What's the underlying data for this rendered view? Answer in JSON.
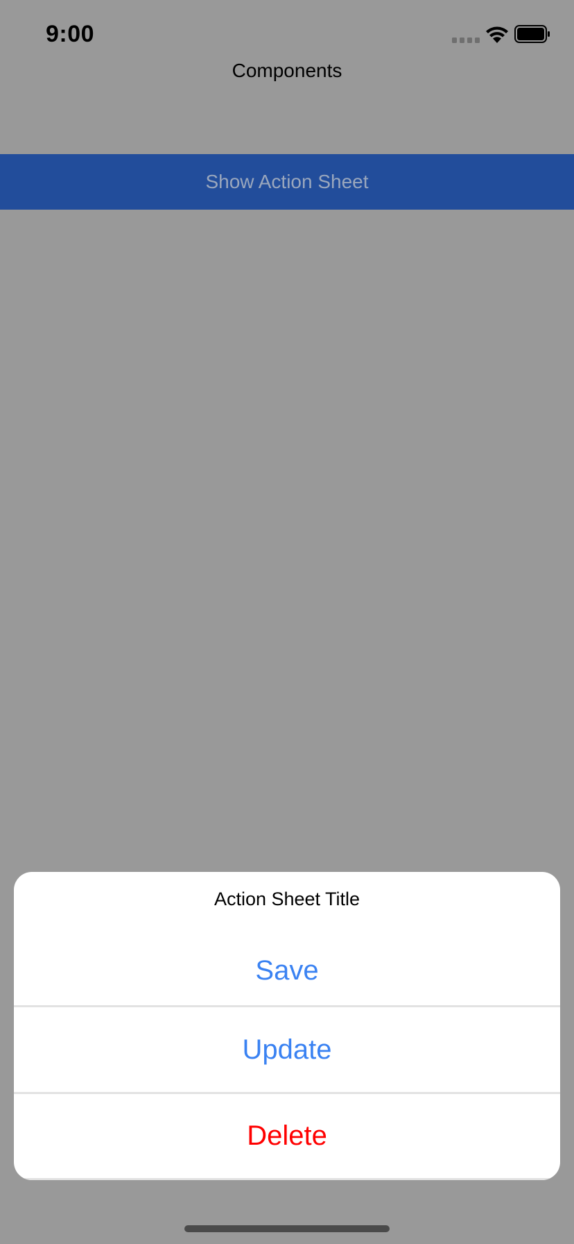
{
  "status_bar": {
    "time": "9:00",
    "icons": [
      "signal-icon",
      "wifi-icon",
      "battery-icon"
    ]
  },
  "navigation": {
    "title": "Components"
  },
  "main": {
    "action_button_label": "Show Action Sheet",
    "action_button_bg": "#224d9b",
    "action_button_text_color": "#9aa7bd"
  },
  "overlay": {
    "backdrop_color": "#999999"
  },
  "action_sheet": {
    "title": "Action Sheet Title",
    "options": [
      {
        "label": "Save",
        "color": "#3a82f2"
      },
      {
        "label": "Update",
        "color": "#3a82f2"
      },
      {
        "label": "Delete",
        "color": "#ff0000"
      }
    ]
  }
}
